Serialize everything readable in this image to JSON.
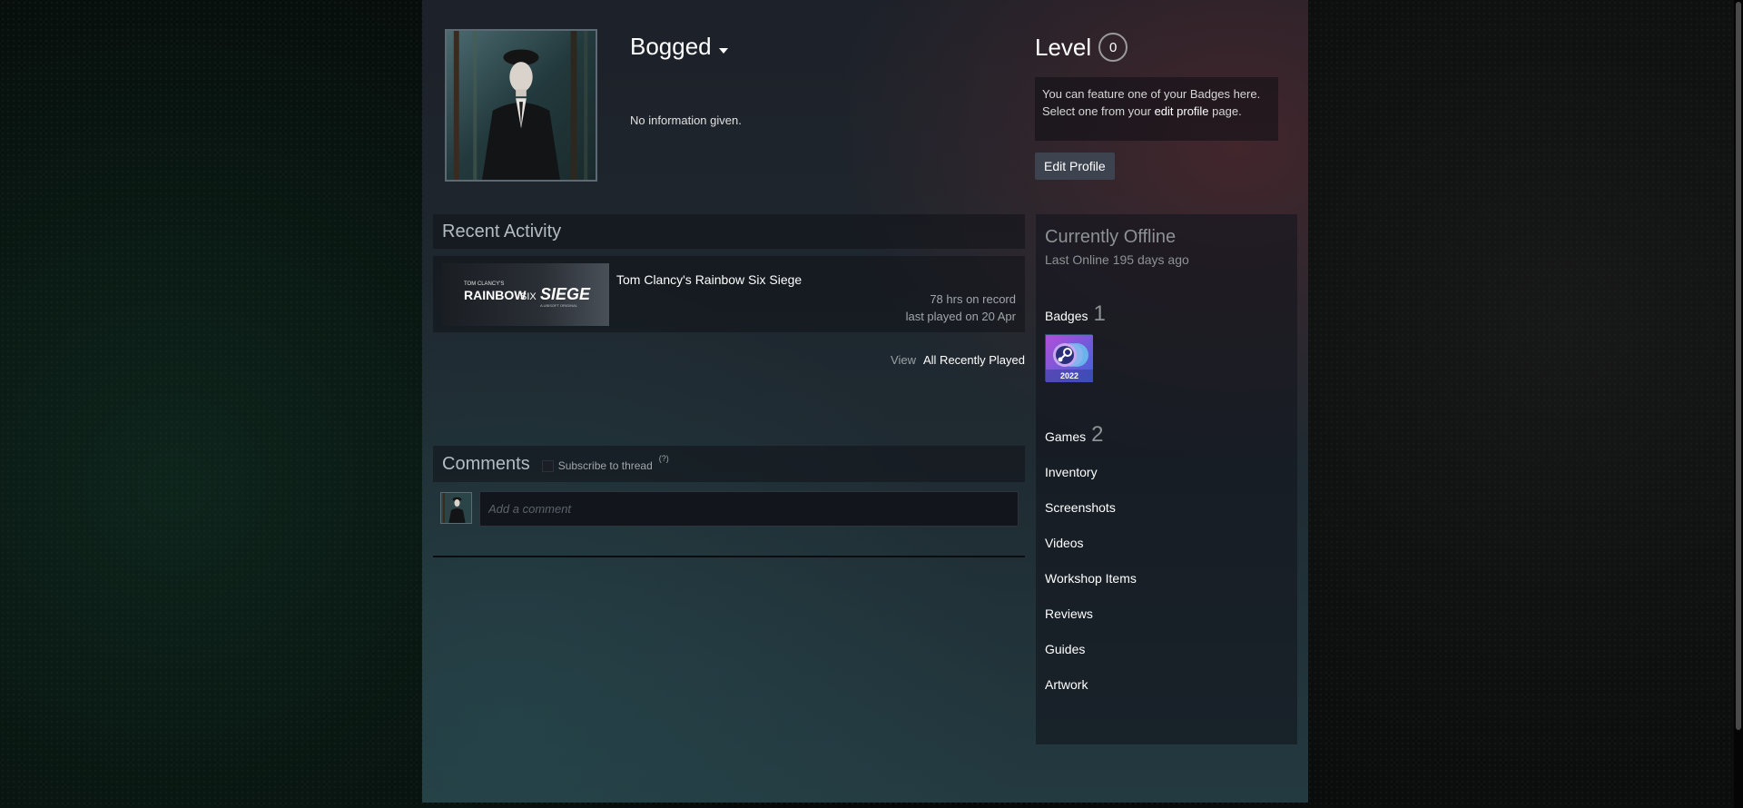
{
  "profile": {
    "persona_name": "Bogged",
    "summary": "No information given.",
    "level_label": "Level",
    "level_value": "0",
    "badge_note_pre": "You can feature one of your Badges here. Select one from your ",
    "badge_note_link": "edit profile",
    "badge_note_post": " page.",
    "edit_profile_label": "Edit Profile"
  },
  "recent_activity": {
    "title": "Recent Activity",
    "games": [
      {
        "name": "Tom Clancy's Rainbow Six Siege",
        "hours": "78 hrs on record",
        "last_played": "last played on 20 Apr",
        "capsule_brand": "TOM CLANCY'S",
        "capsule_title_a": "RAINBOW",
        "capsule_title_b": "SIX",
        "capsule_title_c": "SIEGE",
        "capsule_sub": "A UBISOFT ORIGINAL"
      }
    ],
    "view_label": "View",
    "view_link": "All Recently Played"
  },
  "comments": {
    "title": "Comments",
    "subscribe_label": "Subscribe to thread",
    "help_mark": "(?)",
    "placeholder": "Add a comment"
  },
  "sidebar": {
    "status_title": "Currently Offline",
    "status_sub": "Last Online 195 days ago",
    "badges_label": "Badges",
    "badges_count": "1",
    "badge_year": "2022",
    "games_label": "Games",
    "games_count": "2",
    "links": [
      "Inventory",
      "Screenshots",
      "Videos",
      "Workshop Items",
      "Reviews",
      "Guides",
      "Artwork"
    ]
  },
  "colors": {
    "accent_link": "#ffffff",
    "muted_text": "#8d9295",
    "badge_purple": "#7b3fbf",
    "badge_blue": "#3a8fd8"
  }
}
